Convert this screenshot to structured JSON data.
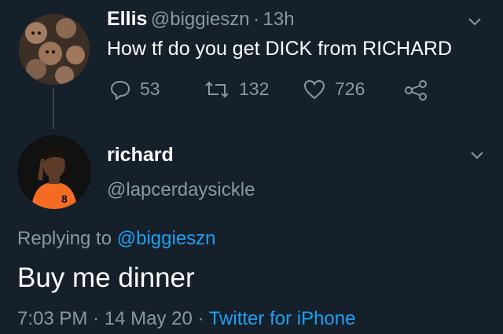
{
  "parent_tweet": {
    "display_name": "Ellis",
    "handle": "@biggieszn",
    "time": "13h",
    "text": "How tf do you get DICK from RICHARD",
    "replies": "53",
    "retweets": "132",
    "likes": "726"
  },
  "reply_tweet": {
    "display_name": "richard",
    "handle": "@lapcerdaysickle",
    "replying_prefix": "Replying to",
    "replying_to": "@biggieszn",
    "text": "Buy me dinner",
    "time": "7:03 PM",
    "date": "14 May 20",
    "source": "Twitter for iPhone"
  },
  "colors": {
    "background": "#15202b",
    "muted": "#8899a6",
    "accent": "#1da1f2",
    "divider": "#38444d"
  },
  "icons": [
    "chevron-down-icon",
    "reply-icon",
    "retweet-icon",
    "like-icon",
    "share-icon"
  ]
}
